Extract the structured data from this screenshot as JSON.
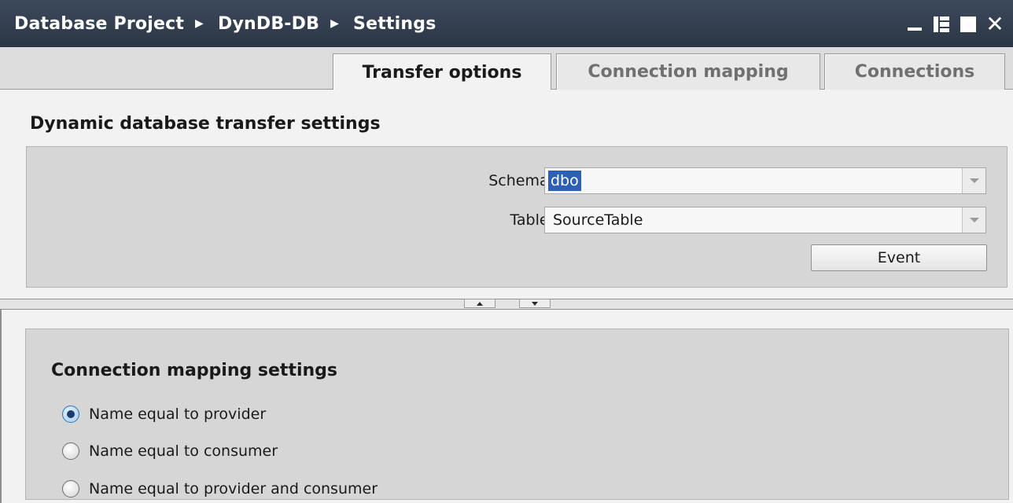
{
  "window": {
    "breadcrumb": [
      "Database Project",
      "DynDB-DB",
      "Settings"
    ],
    "controls": [
      "minimize-icon",
      "float-icon",
      "maximize-icon",
      "close-icon"
    ]
  },
  "tabs": [
    {
      "label": "Transfer options",
      "active": true
    },
    {
      "label": "Connection mapping",
      "active": false
    },
    {
      "label": "Connections",
      "active": false
    }
  ],
  "transfer": {
    "title": "Dynamic database transfer settings",
    "schema_label": "Schema:",
    "schema_value": "dbo",
    "table_label": "Table:",
    "table_value": "SourceTable",
    "event_label": "Event"
  },
  "mapping": {
    "title": "Connection mapping settings",
    "options": [
      {
        "label": "Name equal to provider",
        "checked": true
      },
      {
        "label": "Name equal to consumer",
        "checked": false
      },
      {
        "label": "Name equal to provider and consumer",
        "checked": false
      }
    ]
  },
  "colors": {
    "titlebar": "#2b3545",
    "selection": "#2d5fb5",
    "panel": "#d6d6d6"
  }
}
